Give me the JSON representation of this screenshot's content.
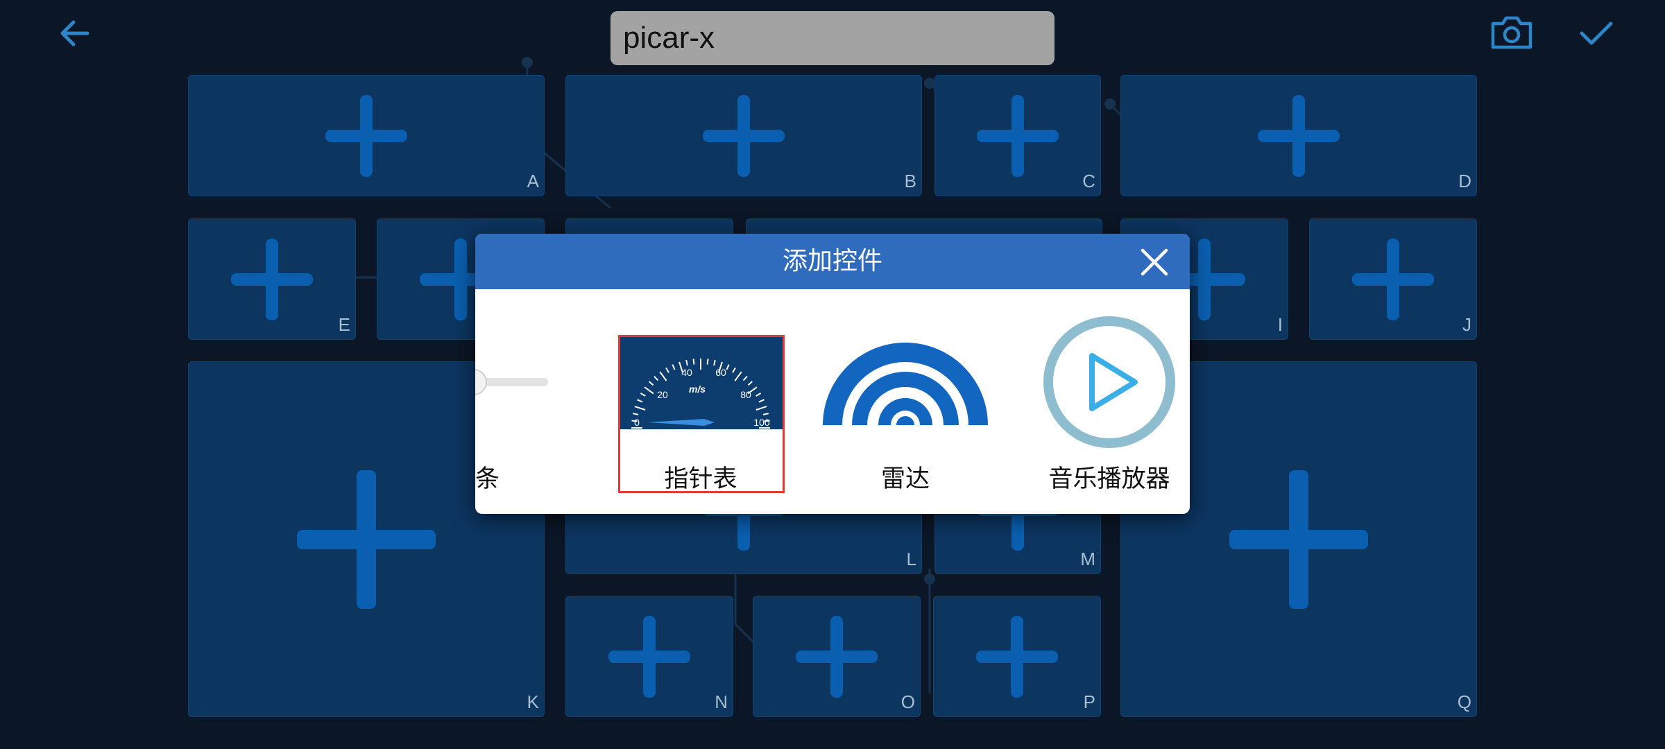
{
  "header": {
    "title_value": "picar-x",
    "icons": {
      "back": "arrow-left-icon",
      "camera": "camera-icon",
      "confirm": "check-icon"
    }
  },
  "slots": [
    {
      "label": "A"
    },
    {
      "label": "B"
    },
    {
      "label": "C"
    },
    {
      "label": "D"
    },
    {
      "label": "E"
    },
    {
      "label": "I"
    },
    {
      "label": "J"
    },
    {
      "label": "K"
    },
    {
      "label": "L"
    },
    {
      "label": "M"
    },
    {
      "label": "N"
    },
    {
      "label": "O"
    },
    {
      "label": "P"
    },
    {
      "label": "Q"
    }
  ],
  "dialog": {
    "title": "添加控件",
    "close_icon": "close-icon",
    "widgets": [
      {
        "label": "滑条",
        "icon": "slider-icon"
      },
      {
        "label": "指针表",
        "icon": "gauge-icon",
        "selected": true,
        "gauge": {
          "unit": "m/s",
          "ticks": [
            "0",
            "20",
            "40",
            "60",
            "80",
            "100"
          ]
        }
      },
      {
        "label": "雷达",
        "icon": "radar-icon"
      },
      {
        "label": "音乐播放器",
        "icon": "play-icon"
      }
    ]
  },
  "colors": {
    "background": "#0b1626",
    "slot": "#0c3560",
    "plus": "#0a5fb0",
    "dialog_header": "#2f6cbe",
    "accent": "#2e86c8",
    "selection": "#e53935"
  }
}
